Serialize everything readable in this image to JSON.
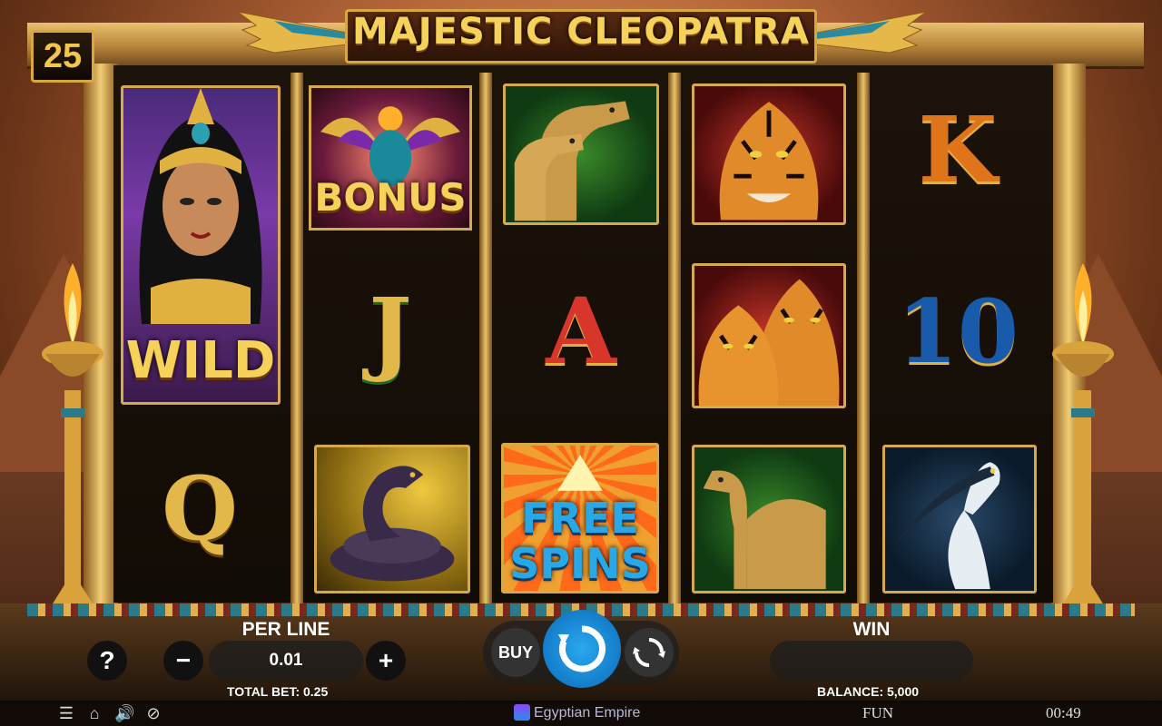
{
  "game": {
    "title": "MAJESTIC CLEOPATRA",
    "paylines": "25"
  },
  "symbols": {
    "wild_label": "WILD",
    "bonus_label": "BONUS",
    "free_spins_line1": "FREE",
    "free_spins_line2": "SPINS",
    "letter_q": "Q",
    "letter_j": "J",
    "letter_a": "A",
    "letter_k": "K",
    "number_10": "10"
  },
  "controls": {
    "per_line_label": "PER LINE",
    "per_line_value": "0.01",
    "total_bet": "TOTAL BET: 0.25",
    "buy_label": "BUY",
    "win_label": "WIN",
    "win_value": "",
    "balance": "BALANCE: 5,000",
    "help_icon": "?",
    "minus_icon": "−",
    "plus_icon": "+"
  },
  "footer": {
    "brand": "Egyptian Empire",
    "mode": "FUN",
    "clock": "00:49"
  },
  "colors": {
    "gold": "#d6a94a",
    "title_gold": "#f6d25a",
    "spin_blue": "#1a8fd6"
  }
}
